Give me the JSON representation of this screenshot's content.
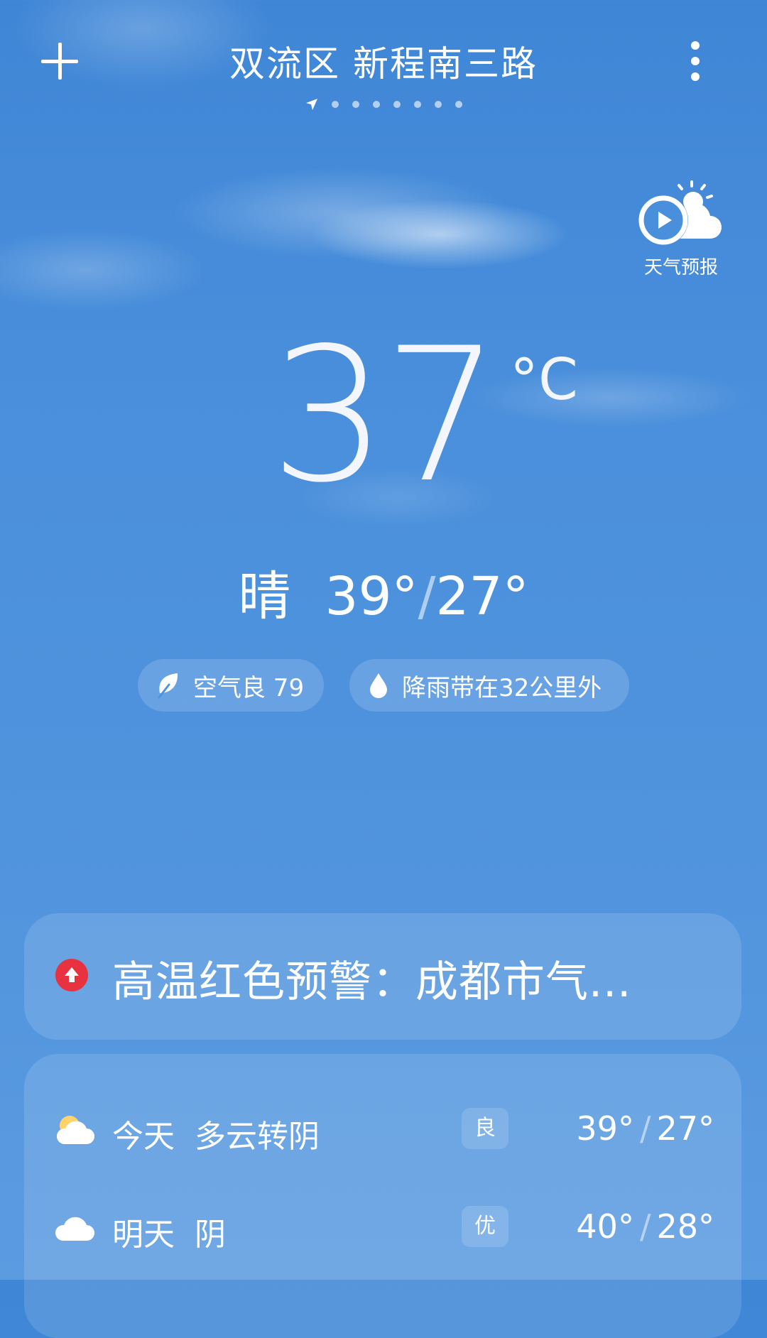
{
  "header": {
    "location": "双流区 新程南三路",
    "page_count": 7
  },
  "forecast_video": {
    "label": "天气预报"
  },
  "current": {
    "temperature": "37",
    "unit": "°C",
    "condition": "晴",
    "high": "39°",
    "low": "27°"
  },
  "chips": {
    "air": "空气良 79",
    "rain": "降雨带在32公里外"
  },
  "alert": {
    "text": "高温红色预警：成都市气...",
    "color": "#e83240"
  },
  "forecast": [
    {
      "day": "今天",
      "condition": "多云转阴",
      "aqi": "良",
      "high": "39°",
      "low": "27°",
      "icon": "partly-cloudy-icon"
    },
    {
      "day": "明天",
      "condition": "阴",
      "aqi": "优",
      "high": "40°",
      "low": "28°",
      "icon": "cloudy-icon"
    }
  ],
  "colors": {
    "sky_top": "#3f86d6",
    "sky_bottom": "#5b9be0",
    "alert_red": "#e83240"
  }
}
